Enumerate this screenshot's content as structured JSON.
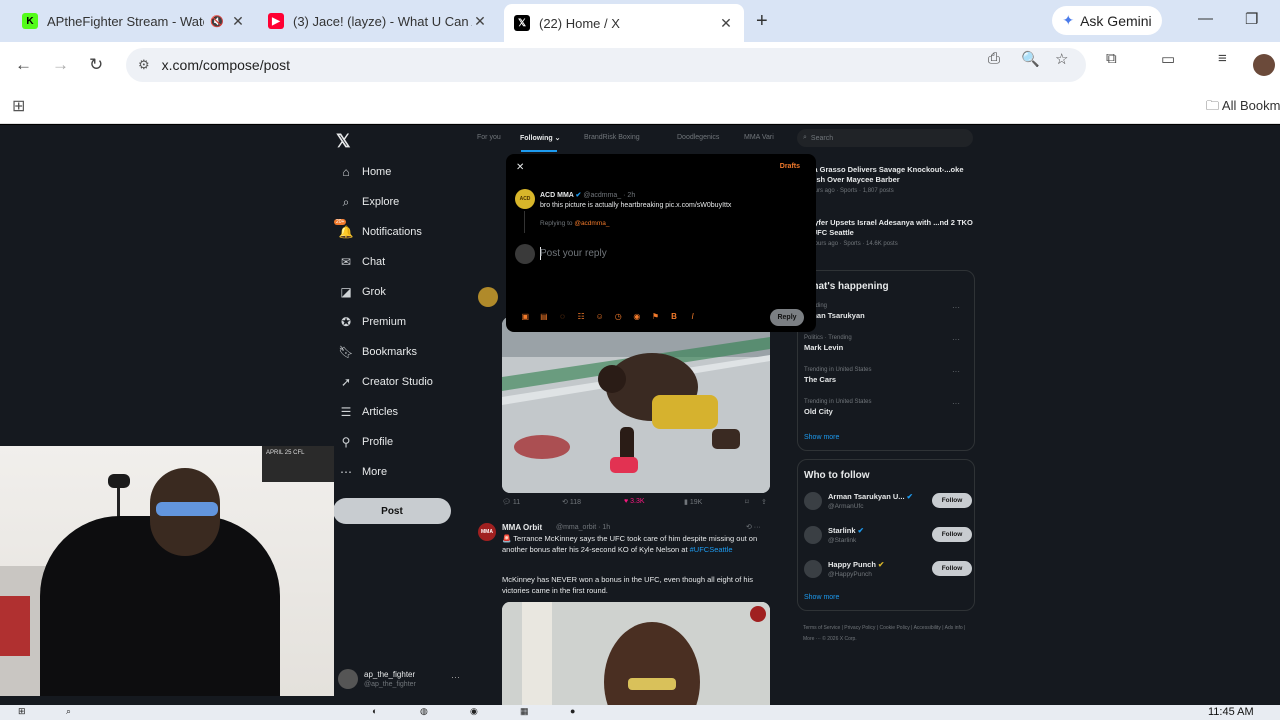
{
  "browser": {
    "tabs": [
      {
        "title": "APtheFighter Stream - Watc",
        "icon": "kick-icon",
        "color": "#53fc18",
        "active": false
      },
      {
        "title": "(3) Jace! (layze) - What U Can A",
        "icon": "youtube-icon",
        "color": "#ff0033",
        "active": false
      },
      {
        "title": "(22) Home / X",
        "icon": "x-icon",
        "color": "#000000",
        "active": true
      }
    ],
    "gemini_label": "Ask Gemini",
    "url": "x.com/compose/post",
    "bookmarks_all": "All Bookm"
  },
  "x": {
    "nav": [
      {
        "label": "Home",
        "icon": "home-icon"
      },
      {
        "label": "Explore",
        "icon": "search-icon"
      },
      {
        "label": "Notifications",
        "icon": "bell-icon"
      },
      {
        "label": "Chat",
        "icon": "mail-icon"
      },
      {
        "label": "Grok",
        "icon": "grok-icon"
      },
      {
        "label": "Premium",
        "icon": "premium-icon"
      },
      {
        "label": "Bookmarks",
        "icon": "bookmark-icon"
      },
      {
        "label": "Creator Studio",
        "icon": "rocket-icon"
      },
      {
        "label": "Articles",
        "icon": "article-icon"
      },
      {
        "label": "Profile",
        "icon": "person-icon"
      },
      {
        "label": "More",
        "icon": "more-icon"
      }
    ],
    "notifications_badge": "20+",
    "post_button": "Post",
    "account": {
      "name": "ap_the_fighter",
      "handle": "@ap_the_fighter"
    },
    "feed_tabs": [
      "For you",
      "Following",
      "BrandRisk Boxing",
      "Doodlegenics",
      "MMA Vari"
    ],
    "search_placeholder": "Search",
    "post_actions": {
      "replies": "11",
      "reposts": "118",
      "likes": "3.3K",
      "views": "19K"
    },
    "post3": {
      "name": "MMA Orbit",
      "handle": "@mma_orbit · 1h",
      "text": "Terrance McKinney says the UFC took care of him despite missing out on another bonus after his 24-second KO of Kyle Nelson at ",
      "hashtag": "#UFCSeattle",
      "text2": "McKinney has NEVER won a bonus in the UFC, even though all eight of his victories came in the first round."
    }
  },
  "modal": {
    "drafts": "Drafts",
    "author": "ACD MMA",
    "handle": "@acdmma_ · 2h",
    "text": "bro this picture is actually heartbreaking pic.x.com/sW0buyIttx",
    "replying_prefix": "Replying to",
    "replying_handle": "@acdmma_",
    "placeholder": "Post your reply",
    "reply_button": "Reply",
    "tools": [
      "media-icon",
      "gif-icon",
      "grok-icon",
      "poll-icon",
      "emoji-icon",
      "schedule-icon",
      "location-icon",
      "flag-icon",
      "bold-icon",
      "italic-icon"
    ]
  },
  "right": {
    "headlines": [
      {
        "title": "...xa Grasso Delivers Savage Knockout-...oke Finish Over Maycee Barber",
        "meta": "6 hours ago · Sports · 1,807 posts"
      },
      {
        "title": "...Pyfer Upsets Israel Adesanya with ...nd 2 TKO at UFC Seattle",
        "meta": "20 hours ago · Sports · 14.6K posts"
      }
    ],
    "happening_title": "...hat's happening",
    "trends": [
      {
        "meta": "...ending",
        "name": "...man Tsarukyan"
      },
      {
        "meta": "Politics · Trending",
        "name": "Mark Levin"
      },
      {
        "meta": "Trending in United States",
        "name": "The Cars"
      },
      {
        "meta": "Trending in United States",
        "name": "Old City"
      }
    ],
    "show_more": "Show more",
    "who_to_follow_title": "Who to follow",
    "follows": [
      {
        "name": "Arman Tsarukyan U...",
        "handle": "@ArmanUfc"
      },
      {
        "name": "Starlink",
        "handle": "@Starlink"
      },
      {
        "name": "Happy Punch",
        "handle": "@HappyPunch"
      }
    ],
    "follow_label": "Follow",
    "footer": "Terms of Service | Privacy Policy | Cookie Policy | Accessibility | Ads info | More ··· © 2026 X Corp."
  },
  "cam_poster": "APRIL 25 CFL",
  "taskbar": {
    "time": "11:45 AM"
  }
}
